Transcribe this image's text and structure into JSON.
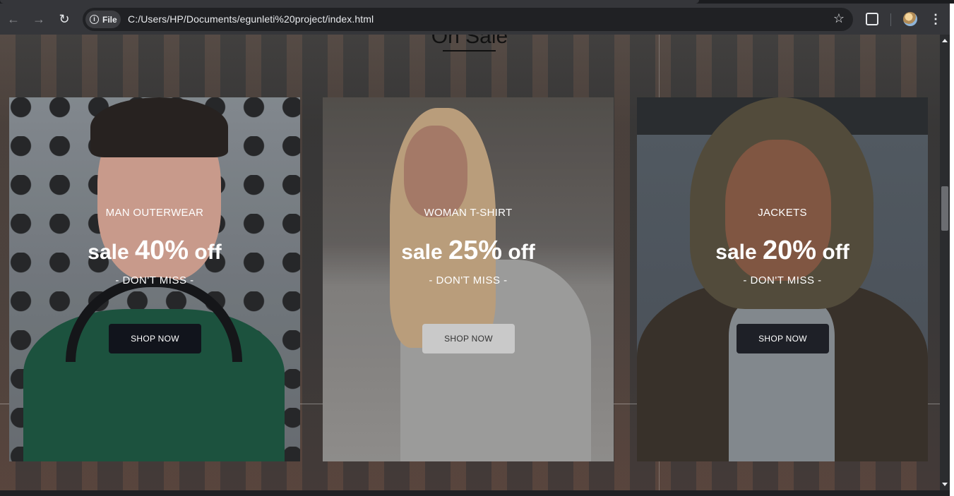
{
  "browser": {
    "chip_label": "File",
    "url": "C:/Users/HP/Documents/egunleti%20project/index.html",
    "icons": [
      "back-icon",
      "forward-icon",
      "reload-icon",
      "info-icon",
      "star-icon",
      "extensions-icon",
      "profile-avatar",
      "menu-icon"
    ]
  },
  "page": {
    "section_title": "On Sale",
    "cards": [
      {
        "category": "MAN OUTERWEAR",
        "sale_prefix": "sale",
        "percent": "40%",
        "sale_suffix": "off",
        "tagline": "- DON'T MISS -",
        "button": "SHOP NOW"
      },
      {
        "category": "WOMAN T-SHIRT",
        "sale_prefix": "sale",
        "percent": "25%",
        "sale_suffix": "off",
        "tagline": "- DON'T MISS -",
        "button": "SHOP NOW"
      },
      {
        "category": "JACKETS",
        "sale_prefix": "sale",
        "percent": "20%",
        "sale_suffix": "off",
        "tagline": "- DON'T MISS -",
        "button": "SHOP NOW"
      }
    ]
  },
  "colors": {
    "chrome_bg": "#35363a",
    "omnibox_bg": "#202124",
    "card_text": "#ffffff",
    "button_dark": "#11141c",
    "button_light": "#c9c9c9"
  }
}
